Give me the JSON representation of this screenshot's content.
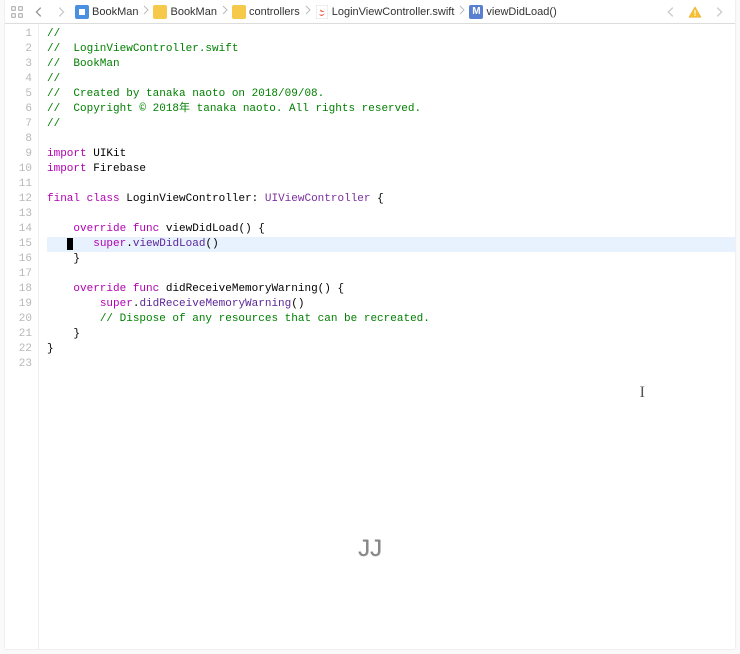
{
  "breadcrumb": {
    "items": [
      {
        "label": "BookMan",
        "icon": "proj"
      },
      {
        "label": "BookMan",
        "icon": "folder"
      },
      {
        "label": "controllers",
        "icon": "folder"
      },
      {
        "label": "LoginViewController.swift",
        "icon": "swift"
      },
      {
        "label": "viewDidLoad()",
        "icon": "method"
      }
    ]
  },
  "overlay": {
    "text": "JJ"
  },
  "current_line": 15,
  "code_lines": [
    {
      "n": 1,
      "tokens": [
        {
          "t": "//",
          "c": "comment"
        }
      ]
    },
    {
      "n": 2,
      "tokens": [
        {
          "t": "//  LoginViewController.swift",
          "c": "comment"
        }
      ]
    },
    {
      "n": 3,
      "tokens": [
        {
          "t": "//  BookMan",
          "c": "comment"
        }
      ]
    },
    {
      "n": 4,
      "tokens": [
        {
          "t": "//",
          "c": "comment"
        }
      ]
    },
    {
      "n": 5,
      "tokens": [
        {
          "t": "//  Created by tanaka naoto on 2018/09/08.",
          "c": "comment"
        }
      ]
    },
    {
      "n": 6,
      "tokens": [
        {
          "t": "//  Copyright © 2018年 tanaka naoto. All rights reserved.",
          "c": "comment"
        }
      ]
    },
    {
      "n": 7,
      "tokens": [
        {
          "t": "//",
          "c": "comment"
        }
      ]
    },
    {
      "n": 8,
      "tokens": [
        {
          "t": "",
          "c": "plain"
        }
      ]
    },
    {
      "n": 9,
      "tokens": [
        {
          "t": "import",
          "c": "keyword"
        },
        {
          "t": " ",
          "c": "plain"
        },
        {
          "t": "UIKit",
          "c": "plain"
        }
      ]
    },
    {
      "n": 10,
      "tokens": [
        {
          "t": "import",
          "c": "keyword"
        },
        {
          "t": " ",
          "c": "plain"
        },
        {
          "t": "Firebase",
          "c": "plain"
        }
      ]
    },
    {
      "n": 11,
      "tokens": [
        {
          "t": "",
          "c": "plain"
        }
      ]
    },
    {
      "n": 12,
      "tokens": [
        {
          "t": "final",
          "c": "keyword"
        },
        {
          "t": " ",
          "c": "plain"
        },
        {
          "t": "class",
          "c": "keyword"
        },
        {
          "t": " ",
          "c": "plain"
        },
        {
          "t": "LoginViewController",
          "c": "plain"
        },
        {
          "t": ": ",
          "c": "plain"
        },
        {
          "t": "UIViewController",
          "c": "systype"
        },
        {
          "t": " {",
          "c": "plain"
        }
      ]
    },
    {
      "n": 13,
      "tokens": [
        {
          "t": "",
          "c": "plain"
        }
      ]
    },
    {
      "n": 14,
      "tokens": [
        {
          "t": "    ",
          "c": "plain"
        },
        {
          "t": "override",
          "c": "keyword"
        },
        {
          "t": " ",
          "c": "plain"
        },
        {
          "t": "func",
          "c": "keyword"
        },
        {
          "t": " ",
          "c": "plain"
        },
        {
          "t": "viewDidLoad",
          "c": "plain"
        },
        {
          "t": "() {",
          "c": "plain"
        }
      ]
    },
    {
      "n": 15,
      "tokens": [
        {
          "t": "   ",
          "c": "plain"
        },
        {
          "t": "CURSOR",
          "c": "cursor"
        },
        {
          "t": "    ",
          "c": "plain"
        },
        {
          "t": "super",
          "c": "keyword"
        },
        {
          "t": ".",
          "c": "plain"
        },
        {
          "t": "viewDidLoad",
          "c": "method"
        },
        {
          "t": "()",
          "c": "plain"
        }
      ]
    },
    {
      "n": 16,
      "tokens": [
        {
          "t": "    }",
          "c": "plain"
        }
      ]
    },
    {
      "n": 17,
      "tokens": [
        {
          "t": "",
          "c": "plain"
        }
      ]
    },
    {
      "n": 18,
      "tokens": [
        {
          "t": "    ",
          "c": "plain"
        },
        {
          "t": "override",
          "c": "keyword"
        },
        {
          "t": " ",
          "c": "plain"
        },
        {
          "t": "func",
          "c": "keyword"
        },
        {
          "t": " ",
          "c": "plain"
        },
        {
          "t": "didReceiveMemoryWarning",
          "c": "plain"
        },
        {
          "t": "() {",
          "c": "plain"
        }
      ]
    },
    {
      "n": 19,
      "tokens": [
        {
          "t": "        ",
          "c": "plain"
        },
        {
          "t": "super",
          "c": "keyword"
        },
        {
          "t": ".",
          "c": "plain"
        },
        {
          "t": "didReceiveMemoryWarning",
          "c": "method"
        },
        {
          "t": "()",
          "c": "plain"
        }
      ]
    },
    {
      "n": 20,
      "tokens": [
        {
          "t": "        ",
          "c": "plain"
        },
        {
          "t": "// Dispose of any resources that can be recreated.",
          "c": "comment"
        }
      ]
    },
    {
      "n": 21,
      "tokens": [
        {
          "t": "    }",
          "c": "plain"
        }
      ]
    },
    {
      "n": 22,
      "tokens": [
        {
          "t": "}",
          "c": "plain"
        }
      ]
    },
    {
      "n": 23,
      "tokens": [
        {
          "t": "",
          "c": "plain"
        }
      ]
    }
  ]
}
